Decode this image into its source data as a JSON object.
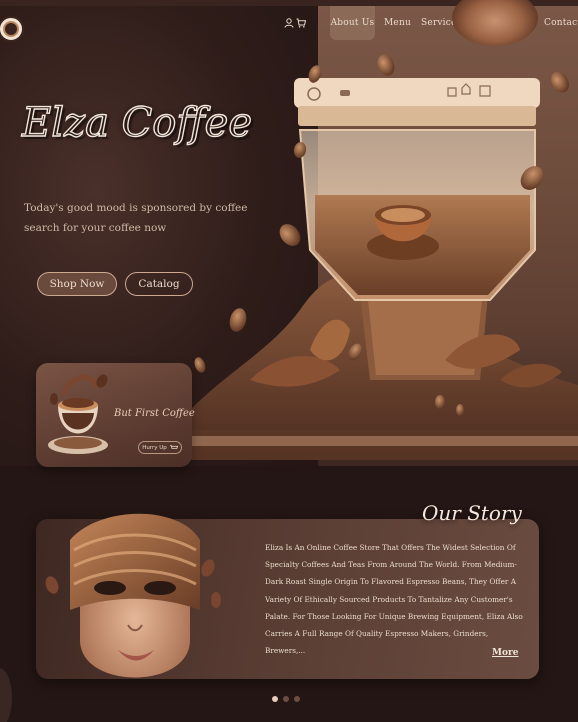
{
  "header": {
    "nav": [
      {
        "label": "About Us",
        "active": true
      },
      {
        "label": "Menu"
      },
      {
        "label": "Service"
      },
      {
        "label": "Contact"
      }
    ],
    "icons": [
      "user-icon",
      "cart-icon"
    ]
  },
  "hero": {
    "title": "Elza Coffee",
    "subtitle_line1": "Today's good mood is sponsored by coffee",
    "subtitle_line2": "search for your coffee now",
    "buttons": {
      "shop": "Shop Now",
      "catalog": "Catalog"
    }
  },
  "promo": {
    "title": "But First Coffee",
    "cta": "Hurry Up"
  },
  "story": {
    "title": "Our Story",
    "lines": [
      "Eliza Is An Online Coffee Store That Offers The Widest Selection Of",
      "Specialty Coffees And Teas From Around The World. From Medium-",
      "Dark Roast Single Origin To Flavored Espresso Beans, They Offer A",
      "Variety Of Ethically Sourced Products To Tantalize Any Customer's",
      "Palate. For Those Looking For Unique Brewing Equipment, Eliza Also",
      "Carries A Full Range Of Quality Espresso Makers, Grinders, Brewers,..."
    ],
    "more": "More"
  },
  "carousel": {
    "count": 3,
    "active": 1
  },
  "colors": {
    "background": "#241614",
    "accent": "#8b6a58",
    "text": "#e9d8c6"
  }
}
